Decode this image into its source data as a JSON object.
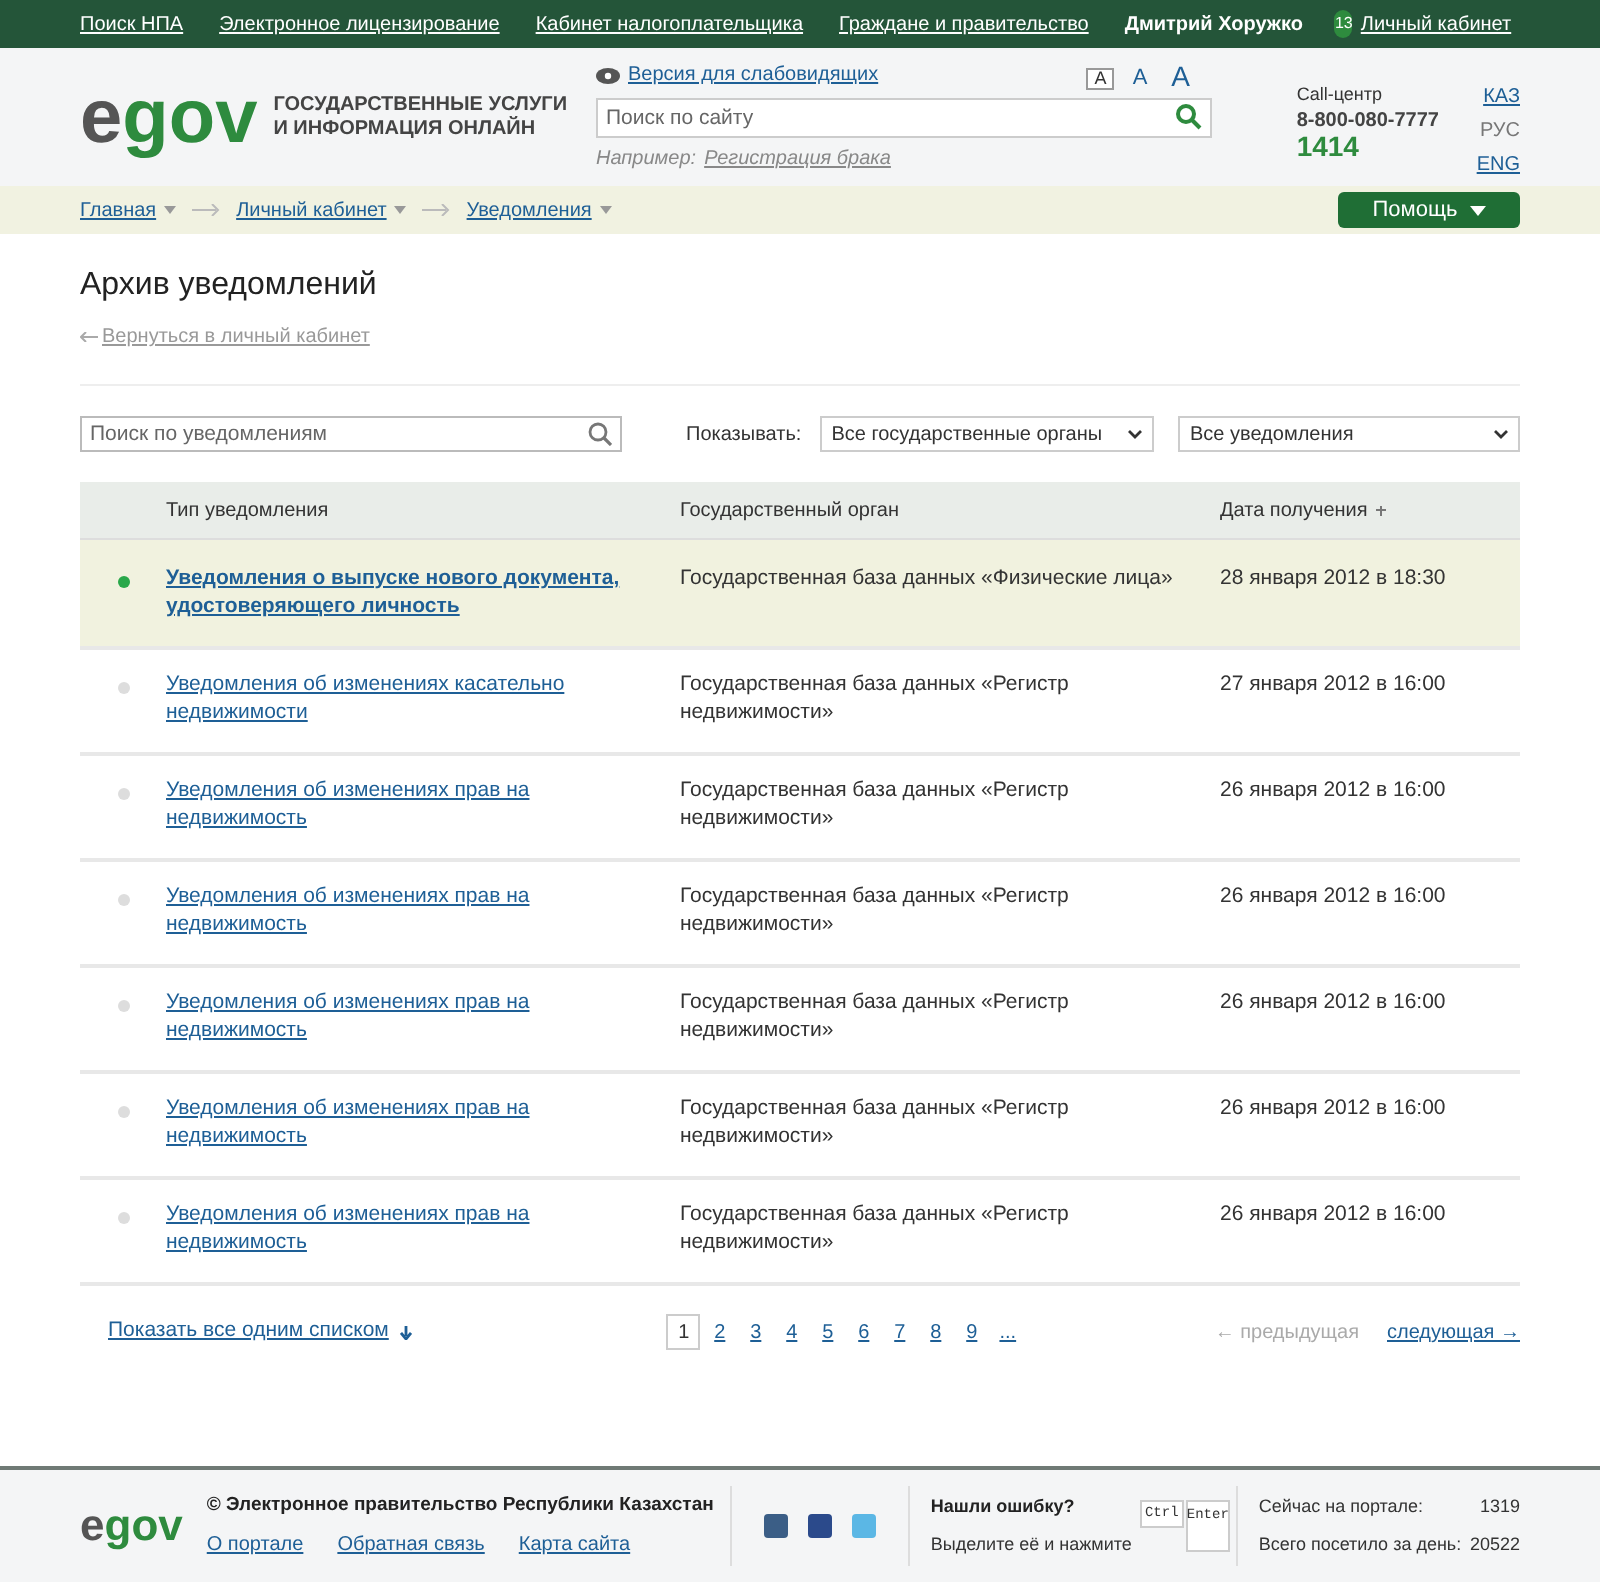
{
  "top_nav": {
    "links": [
      "Поиск НПА",
      "Электронное лицензирование",
      "Кабинет налогоплательщика",
      "Граждане и правительство"
    ],
    "user": "Дмитрий Хоружко",
    "badge": "13",
    "cabinet": "Личный кабинет"
  },
  "header": {
    "logo": {
      "e": "e",
      "gov": "gov"
    },
    "tagline": [
      "ГОСУДАРСТВЕННЫЕ УСЛУГИ",
      "И ИНФОРМАЦИЯ ОНЛАЙН"
    ],
    "accessibility": "Версия для слабовидящих",
    "font_sizes": [
      {
        "label": "A",
        "selected": true
      },
      {
        "label": "A",
        "selected": false
      },
      {
        "label": "A",
        "selected": false
      }
    ],
    "search": {
      "placeholder": "Поиск по сайту"
    },
    "example_label": "Например:",
    "example_link": "Регистрация брака",
    "call_center": "Call-центр",
    "phone": "8-800-080-7777",
    "short_number": "1414",
    "languages": [
      {
        "label": "КАЗ",
        "selected": false
      },
      {
        "label": "РУС",
        "selected": true
      },
      {
        "label": "ENG",
        "selected": false
      }
    ]
  },
  "breadcrumbs": [
    "Главная",
    "Личный кабинет",
    "Уведомления"
  ],
  "help_button": "Помощь",
  "page_title": "Архив уведомлений",
  "back_link": "Вернуться в личный кабинет",
  "filters": {
    "search": {
      "placeholder": "Поиск по уведомлениям"
    },
    "show_label": "Показывать:",
    "agency_select": "Все государственные органы",
    "type_select": "Все уведомления"
  },
  "table": {
    "columns": [
      "Тип уведомления",
      "Государственный орган",
      "Дата получения"
    ],
    "rows": [
      {
        "unread": true,
        "type": "Уведомления о выпуске нового документа, удостоверяющего личность",
        "agency": "Государственная база данных «Физические лица»",
        "date": "28 января 2012 в 18:30"
      },
      {
        "unread": false,
        "type": "Уведомления об изменениях касательно недвижимости",
        "agency": "Государственная база данных «Регистр недвижимости»",
        "date": "27 января 2012 в 16:00"
      },
      {
        "unread": false,
        "type": "Уведомления об изменениях прав на недвижимость",
        "agency": "Государственная база данных «Регистр недвижимости»",
        "date": "26 января 2012 в 16:00"
      },
      {
        "unread": false,
        "type": "Уведомления об изменениях прав на недвижимость",
        "agency": "Государственная база данных «Регистр недвижимости»",
        "date": "26 января 2012 в 16:00"
      },
      {
        "unread": false,
        "type": "Уведомления об изменениях прав на недвижимость",
        "agency": "Государственная база данных «Регистр недвижимости»",
        "date": "26 января 2012 в 16:00"
      },
      {
        "unread": false,
        "type": "Уведомления об изменениях прав на недвижимость",
        "agency": "Государственная база данных «Регистр недвижимости»",
        "date": "26 января 2012 в 16:00"
      },
      {
        "unread": false,
        "type": "Уведомления об изменениях прав на недвижимость",
        "agency": "Государственная база данных «Регистр недвижимости»",
        "date": "26 января 2012 в 16:00"
      }
    ]
  },
  "show_all": "Показать все одним списком",
  "pages": [
    {
      "label": "1",
      "selected": true
    },
    {
      "label": "2",
      "selected": false
    },
    {
      "label": "3",
      "selected": false
    },
    {
      "label": "4",
      "selected": false
    },
    {
      "label": "5",
      "selected": false
    },
    {
      "label": "6",
      "selected": false
    },
    {
      "label": "7",
      "selected": false
    },
    {
      "label": "8",
      "selected": false
    },
    {
      "label": "9",
      "selected": false
    },
    {
      "label": "...",
      "selected": false
    }
  ],
  "prev": {
    "label": "← предыдущая",
    "disabled": true
  },
  "next": {
    "label": "следующая →",
    "disabled": false
  },
  "footer": {
    "logo": {
      "e": "e",
      "gov": "gov"
    },
    "copyright": "© Электронное правительство Республики Казахстан",
    "links": [
      "О портале",
      "Обратная связь",
      "Карта сайта"
    ],
    "error_title": "Нашли ошибку?",
    "error_hint": "Выделите её и нажмите",
    "keys": [
      "Ctrl",
      "Enter"
    ],
    "stats": [
      {
        "label": "Сейчас на портале:",
        "value": "1319"
      },
      {
        "label": "Всего посетило за день:",
        "value": "20522"
      }
    ]
  }
}
